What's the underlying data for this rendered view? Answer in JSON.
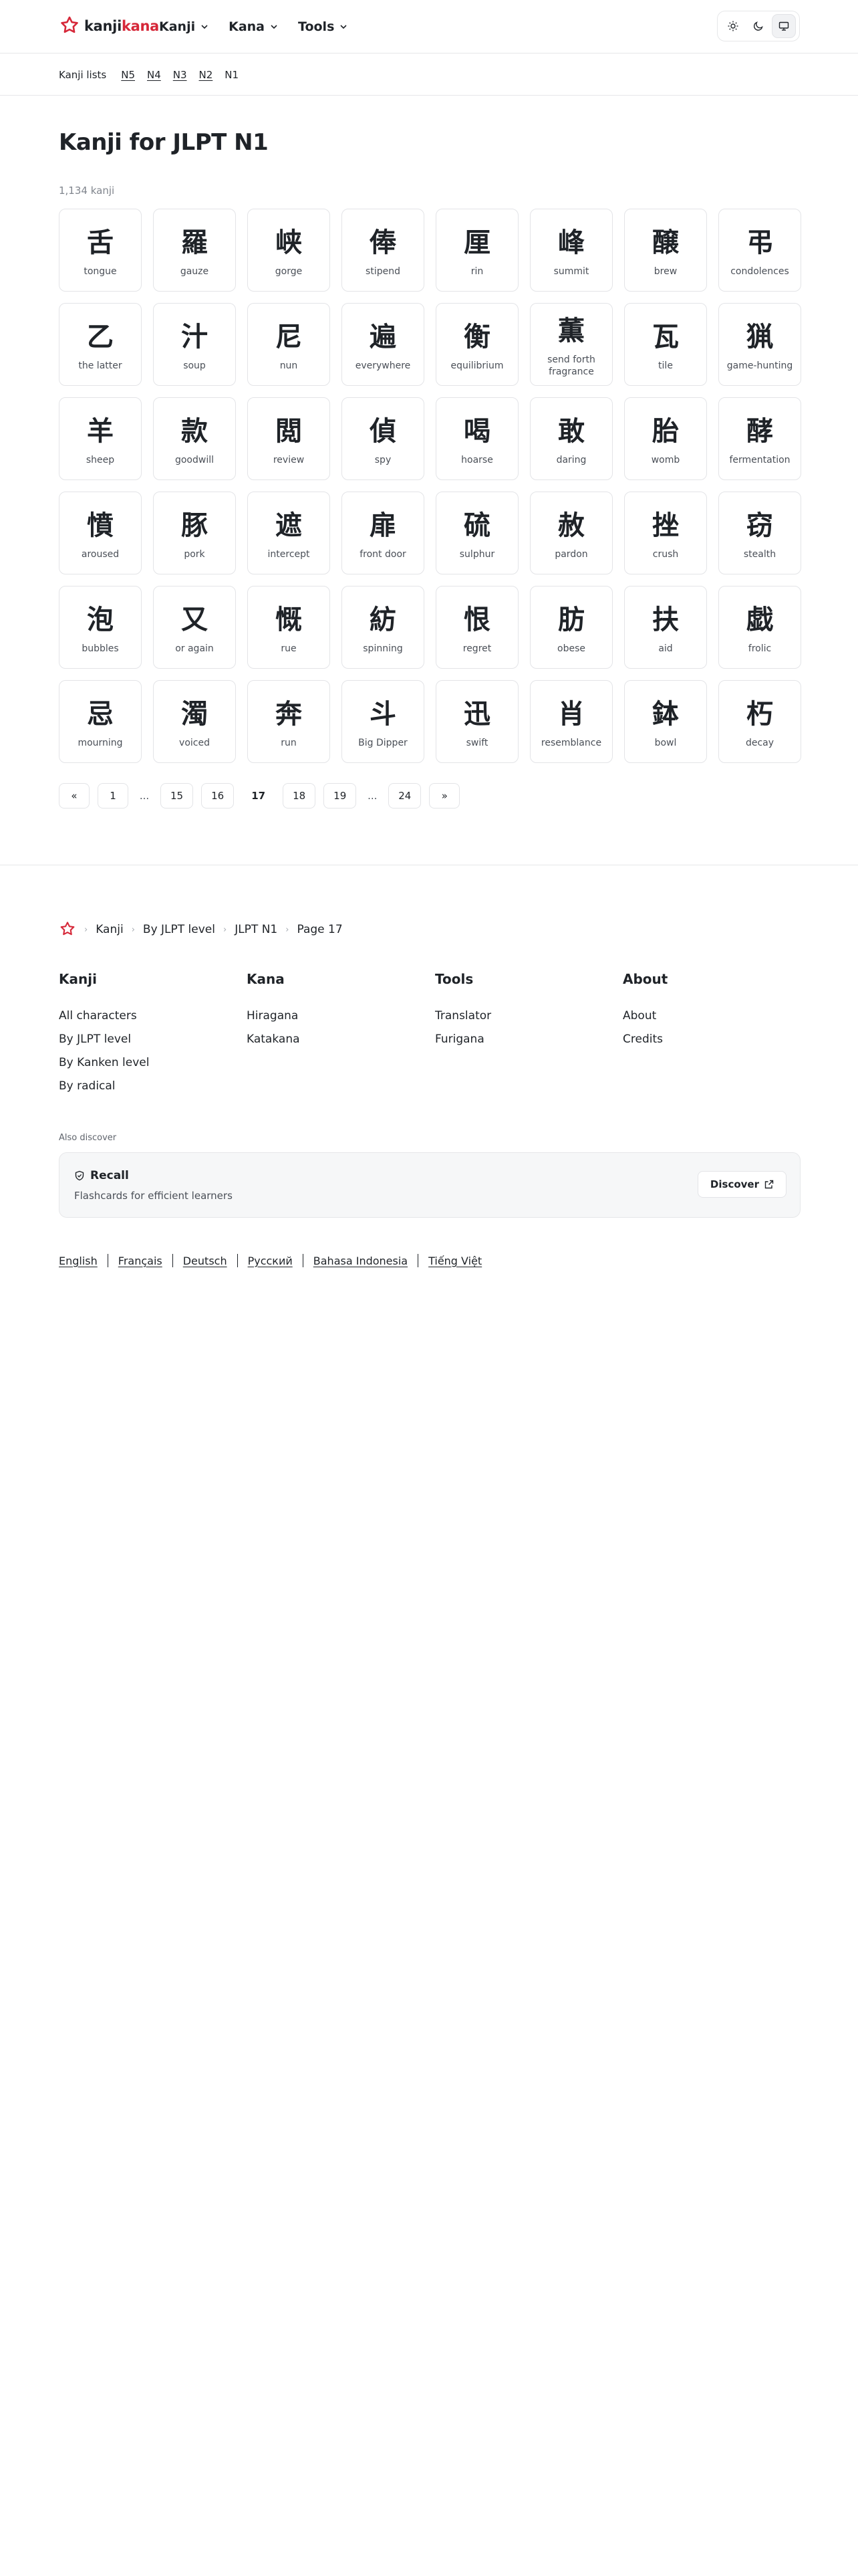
{
  "brand": {
    "name_a": "kanji",
    "name_b": "kana",
    "accent": "#d62839"
  },
  "nav": [
    {
      "label": "Kanji"
    },
    {
      "label": "Kana"
    },
    {
      "label": "Tools"
    }
  ],
  "theme": {
    "icons": [
      "sun-icon",
      "moon-icon",
      "monitor-icon"
    ],
    "active": "monitor-icon"
  },
  "subnav": {
    "label": "Kanji lists",
    "levels": [
      "N5",
      "N4",
      "N3",
      "N2"
    ],
    "current": "N1"
  },
  "page": {
    "title": "Kanji for JLPT N1",
    "count": "1,134 kanji"
  },
  "kanji": [
    {
      "k": "舌",
      "m": "tongue"
    },
    {
      "k": "羅",
      "m": "gauze"
    },
    {
      "k": "峡",
      "m": "gorge"
    },
    {
      "k": "俸",
      "m": "stipend"
    },
    {
      "k": "厘",
      "m": "rin"
    },
    {
      "k": "峰",
      "m": "summit"
    },
    {
      "k": "醸",
      "m": "brew"
    },
    {
      "k": "弔",
      "m": "condolences"
    },
    {
      "k": "乙",
      "m": "the latter"
    },
    {
      "k": "汁",
      "m": "soup"
    },
    {
      "k": "尼",
      "m": "nun"
    },
    {
      "k": "遍",
      "m": "everywhere"
    },
    {
      "k": "衡",
      "m": "equilibrium"
    },
    {
      "k": "薫",
      "m": "send forth fragrance"
    },
    {
      "k": "瓦",
      "m": "tile"
    },
    {
      "k": "猟",
      "m": "game-hunting"
    },
    {
      "k": "羊",
      "m": "sheep"
    },
    {
      "k": "款",
      "m": "goodwill"
    },
    {
      "k": "閲",
      "m": "review"
    },
    {
      "k": "偵",
      "m": "spy"
    },
    {
      "k": "喝",
      "m": "hoarse"
    },
    {
      "k": "敢",
      "m": "daring"
    },
    {
      "k": "胎",
      "m": "womb"
    },
    {
      "k": "酵",
      "m": "fermentation"
    },
    {
      "k": "憤",
      "m": "aroused"
    },
    {
      "k": "豚",
      "m": "pork"
    },
    {
      "k": "遮",
      "m": "intercept"
    },
    {
      "k": "扉",
      "m": "front door"
    },
    {
      "k": "硫",
      "m": "sulphur"
    },
    {
      "k": "赦",
      "m": "pardon"
    },
    {
      "k": "挫",
      "m": "crush"
    },
    {
      "k": "窃",
      "m": "stealth"
    },
    {
      "k": "泡",
      "m": "bubbles"
    },
    {
      "k": "又",
      "m": "or again"
    },
    {
      "k": "慨",
      "m": "rue"
    },
    {
      "k": "紡",
      "m": "spinning"
    },
    {
      "k": "恨",
      "m": "regret"
    },
    {
      "k": "肪",
      "m": "obese"
    },
    {
      "k": "扶",
      "m": "aid"
    },
    {
      "k": "戯",
      "m": "frolic"
    },
    {
      "k": "忌",
      "m": "mourning"
    },
    {
      "k": "濁",
      "m": "voiced"
    },
    {
      "k": "奔",
      "m": "run"
    },
    {
      "k": "斗",
      "m": "Big Dipper"
    },
    {
      "k": "迅",
      "m": "swift"
    },
    {
      "k": "肖",
      "m": "resemblance"
    },
    {
      "k": "鉢",
      "m": "bowl"
    },
    {
      "k": "朽",
      "m": "decay"
    }
  ],
  "pagination": {
    "prev": "«",
    "next": "»",
    "ellipsis": "...",
    "pages": [
      "1",
      "15",
      "16",
      "17",
      "18",
      "19",
      "24"
    ],
    "current": "17"
  },
  "footer": {
    "crumbs": [
      "Kanji",
      "By JLPT level",
      "JLPT N1",
      "Page 17"
    ],
    "columns": [
      {
        "title": "Kanji",
        "links": [
          "All characters",
          "By JLPT level",
          "By Kanken level",
          "By radical"
        ]
      },
      {
        "title": "Kana",
        "links": [
          "Hiragana",
          "Katakana"
        ]
      },
      {
        "title": "Tools",
        "links": [
          "Translator",
          "Furigana"
        ]
      },
      {
        "title": "About",
        "links": [
          "About",
          "Credits"
        ]
      }
    ],
    "also": "Also discover",
    "recall": {
      "title": "Recall",
      "subtitle": "Flashcards for efficient learners",
      "button": "Discover"
    },
    "languages": [
      "English",
      "Français",
      "Deutsch",
      "Русский",
      "Bahasa Indonesia",
      "Tiếng Việt"
    ]
  }
}
